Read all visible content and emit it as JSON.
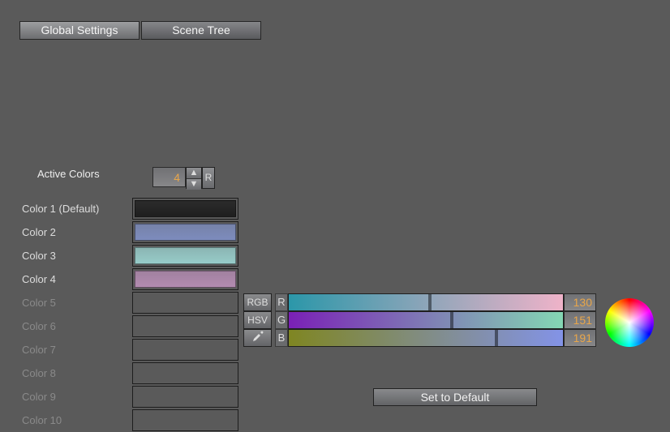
{
  "tabs": [
    {
      "label": "Global Settings",
      "active": true
    },
    {
      "label": "Scene Tree",
      "active": false
    }
  ],
  "active_colors": {
    "label": "Active Colors",
    "value": "4",
    "reset_label": "R"
  },
  "colors": [
    {
      "label": "Color 1 (Default)",
      "active": true,
      "hex": "#1f1f1f"
    },
    {
      "label": "Color 2",
      "active": true,
      "hex": "#7d8cbd"
    },
    {
      "label": "Color 3",
      "active": true,
      "hex": "#97ccc9"
    },
    {
      "label": "Color 4",
      "active": true,
      "hex": "#b38bb1"
    },
    {
      "label": "Color 5",
      "active": false,
      "hex": null
    },
    {
      "label": "Color 6",
      "active": false,
      "hex": null
    },
    {
      "label": "Color 7",
      "active": false,
      "hex": null
    },
    {
      "label": "Color 8",
      "active": false,
      "hex": null
    },
    {
      "label": "Color 9",
      "active": false,
      "hex": null
    },
    {
      "label": "Color 10",
      "active": false,
      "hex": null
    }
  ],
  "rgb_buttons": {
    "rgb": "RGB",
    "hsv": "HSV"
  },
  "channels": [
    {
      "label": "R",
      "value": "130",
      "grad_from": "#2b97a9",
      "grad_to": "#efb3c9",
      "thumb": 0.51
    },
    {
      "label": "G",
      "value": "151",
      "grad_from": "#7a20b6",
      "grad_to": "#84d7b4",
      "thumb": 0.59
    },
    {
      "label": "B",
      "value": "191",
      "grad_from": "#7f8622",
      "grad_to": "#8393e7",
      "thumb": 0.75
    }
  ],
  "default_btn": "Set to Default"
}
